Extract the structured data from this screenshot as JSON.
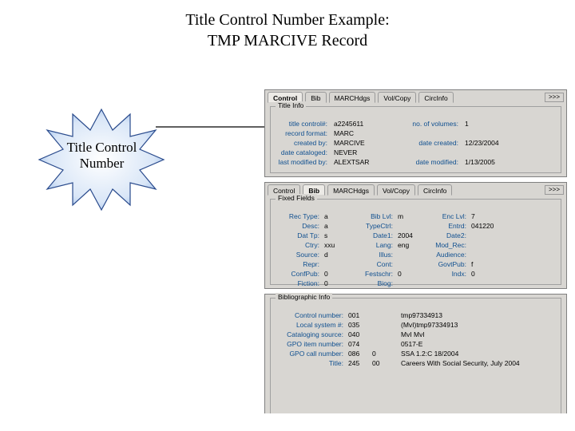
{
  "title_line1": "Title Control Number Example:",
  "title_line2": "TMP MARCIVE Record",
  "callout": {
    "line1": "Title Control",
    "line2": "Number"
  },
  "tabs": {
    "control": "Control",
    "bib": "Bib",
    "marc": "MARCHdgs",
    "vol": "Vol/Copy",
    "circ": "CircInfo",
    "more": ">>>"
  },
  "title_info": {
    "legend": "Title Info",
    "rows": [
      {
        "l1": "title control#:",
        "v1": "a2245611",
        "l2": "no. of volumes:",
        "v2": "1"
      },
      {
        "l1": "record format:",
        "v1": "MARC",
        "l2": "",
        "v2": ""
      },
      {
        "l1": "created by:",
        "v1": "MARCIVE",
        "l2": "date created:",
        "v2": "12/23/2004"
      },
      {
        "l1": "date cataloged:",
        "v1": "NEVER",
        "l2": "",
        "v2": ""
      },
      {
        "l1": "last modified by:",
        "v1": "ALEXTSAR",
        "l2": "date modified:",
        "v2": "1/13/2005"
      }
    ]
  },
  "fixed": {
    "legend": "Fixed Fields",
    "rows": [
      {
        "c": [
          "Rec Type:",
          "a",
          "Bib Lvl:",
          "m",
          "Enc Lvl:",
          "7"
        ]
      },
      {
        "c": [
          "Desc:",
          "a",
          "TypeCtrl:",
          "",
          "Entrd:",
          "041220"
        ]
      },
      {
        "c": [
          "Dat Tp:",
          "s",
          "Date1:",
          "2004",
          "Date2:",
          ""
        ]
      },
      {
        "c": [
          "Ctry:",
          "xxu",
          "Lang:",
          "eng",
          "Mod_Rec:",
          ""
        ]
      },
      {
        "c": [
          "Source:",
          "d",
          "Illus:",
          "",
          "Audience:",
          ""
        ]
      },
      {
        "c": [
          "Repr:",
          "",
          "Cont:",
          "",
          "GovtPub:",
          "f"
        ]
      },
      {
        "c": [
          "ConfPub:",
          "0",
          "Festschr:",
          "0",
          "Indx:",
          "0"
        ]
      },
      {
        "c": [
          "Fiction:",
          "0",
          "Biog:",
          "",
          "",
          ""
        ]
      }
    ]
  },
  "biblio": {
    "legend": "Bibliographic Info",
    "rows": [
      {
        "l": "Control number:",
        "t": "001",
        "i": "",
        "v": "tmp97334913"
      },
      {
        "l": "Local system #:",
        "t": "035",
        "i": "",
        "v": "(MvI)tmp97334913"
      },
      {
        "l": "Cataloging source:",
        "t": "040",
        "i": "",
        "v": "MvI MvI"
      },
      {
        "l": "GPO item number:",
        "t": "074",
        "i": "",
        "v": "0517-E"
      },
      {
        "l": "GPO call number:",
        "t": "086",
        "i": "0",
        "v": "SSA 1.2:C 18/2004"
      },
      {
        "l": "Title:",
        "t": "245",
        "i": "00",
        "v": "Careers With Social Security, July 2004"
      }
    ]
  }
}
